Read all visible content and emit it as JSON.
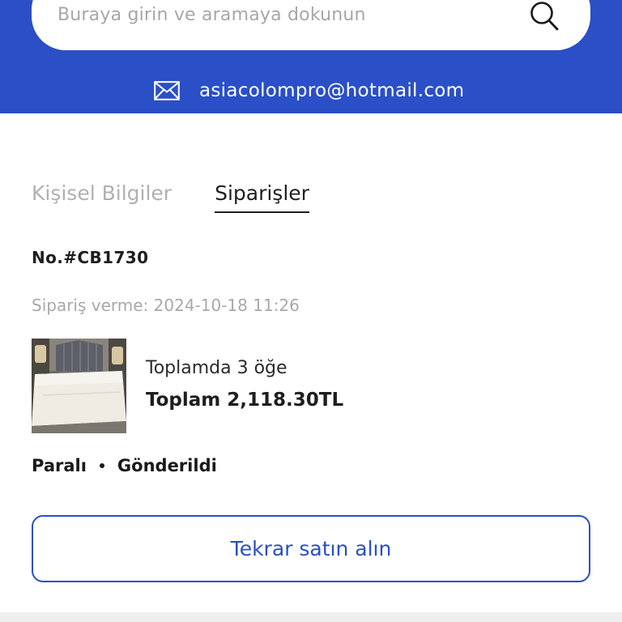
{
  "search": {
    "placeholder": "Buraya girin ve aramaya dokunun"
  },
  "header": {
    "email": "asiacolompro@hotmail.com"
  },
  "tabs": [
    {
      "label": "Kişisel Bilgiler",
      "active": false
    },
    {
      "label": "Siparişler",
      "active": true
    }
  ],
  "order": {
    "number": "No.#CB1730",
    "date": "Sipariş verme: 2024-10-18 11:26",
    "item_count": "Toplamda 3 öğe",
    "total": "Toplam 2,118.30TL",
    "payment_status": "Paralı",
    "shipping_status": "Gönderildi"
  },
  "actions": {
    "rebuy": "Tekrar satın alın"
  },
  "colors": {
    "brand": "#2a4fc6",
    "muted": "#a9a9a9",
    "text": "#1e1e1e"
  },
  "icons": {
    "search": "search-icon",
    "mail": "mail-icon"
  }
}
